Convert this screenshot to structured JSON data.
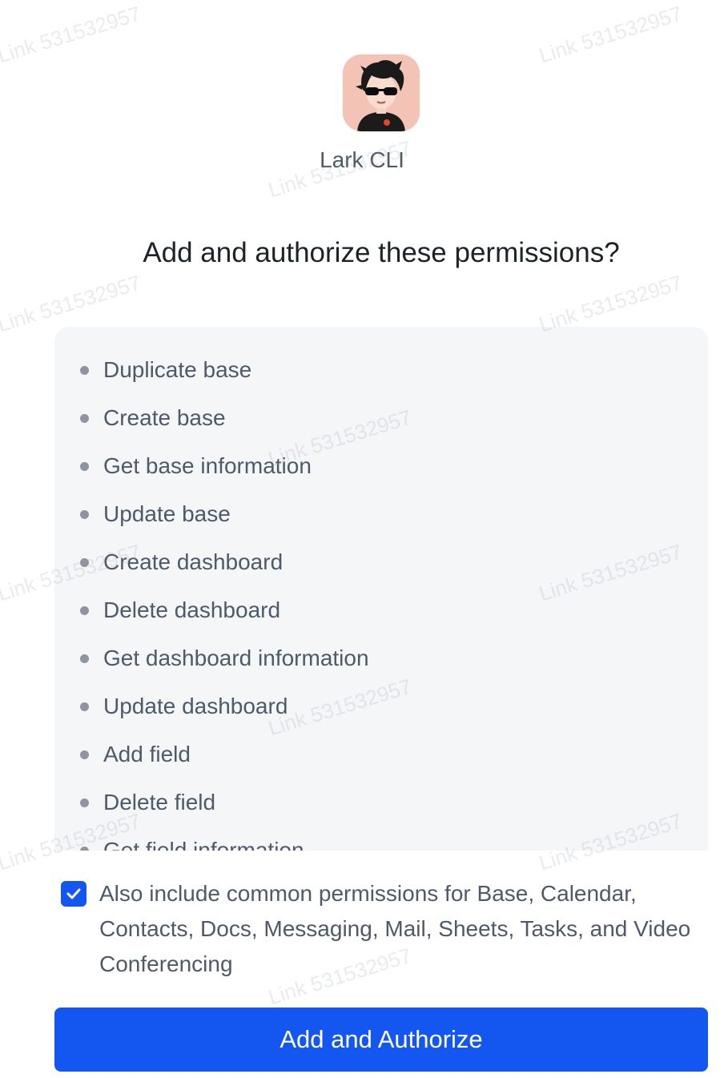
{
  "app": {
    "name": "Lark CLI"
  },
  "dialog": {
    "title": "Add and authorize these permissions?"
  },
  "permissions": [
    "Duplicate base",
    "Create base",
    "Get base information",
    "Update base",
    "Create dashboard",
    "Delete dashboard",
    "Get dashboard information",
    "Update dashboard",
    "Add field",
    "Delete field",
    "Get field information"
  ],
  "common_permissions": {
    "checked": true,
    "label": "Also include common permissions for Base, Calendar, Contacts, Docs, Messaging, Mail, Sheets, Tasks, and Video Conferencing"
  },
  "actions": {
    "primary_label": "Add and Authorize"
  },
  "watermark": {
    "text": "Link 531532957"
  },
  "colors": {
    "accent": "#1456f0",
    "list_background": "#f5f6f8",
    "secondary_text": "#4e5969",
    "title_text": "#1f2329"
  },
  "icons": {
    "avatar": "cartoon-avatar-with-sunglasses",
    "bullet": "dot-bullet-icon",
    "checkbox": "checkmark-icon"
  }
}
